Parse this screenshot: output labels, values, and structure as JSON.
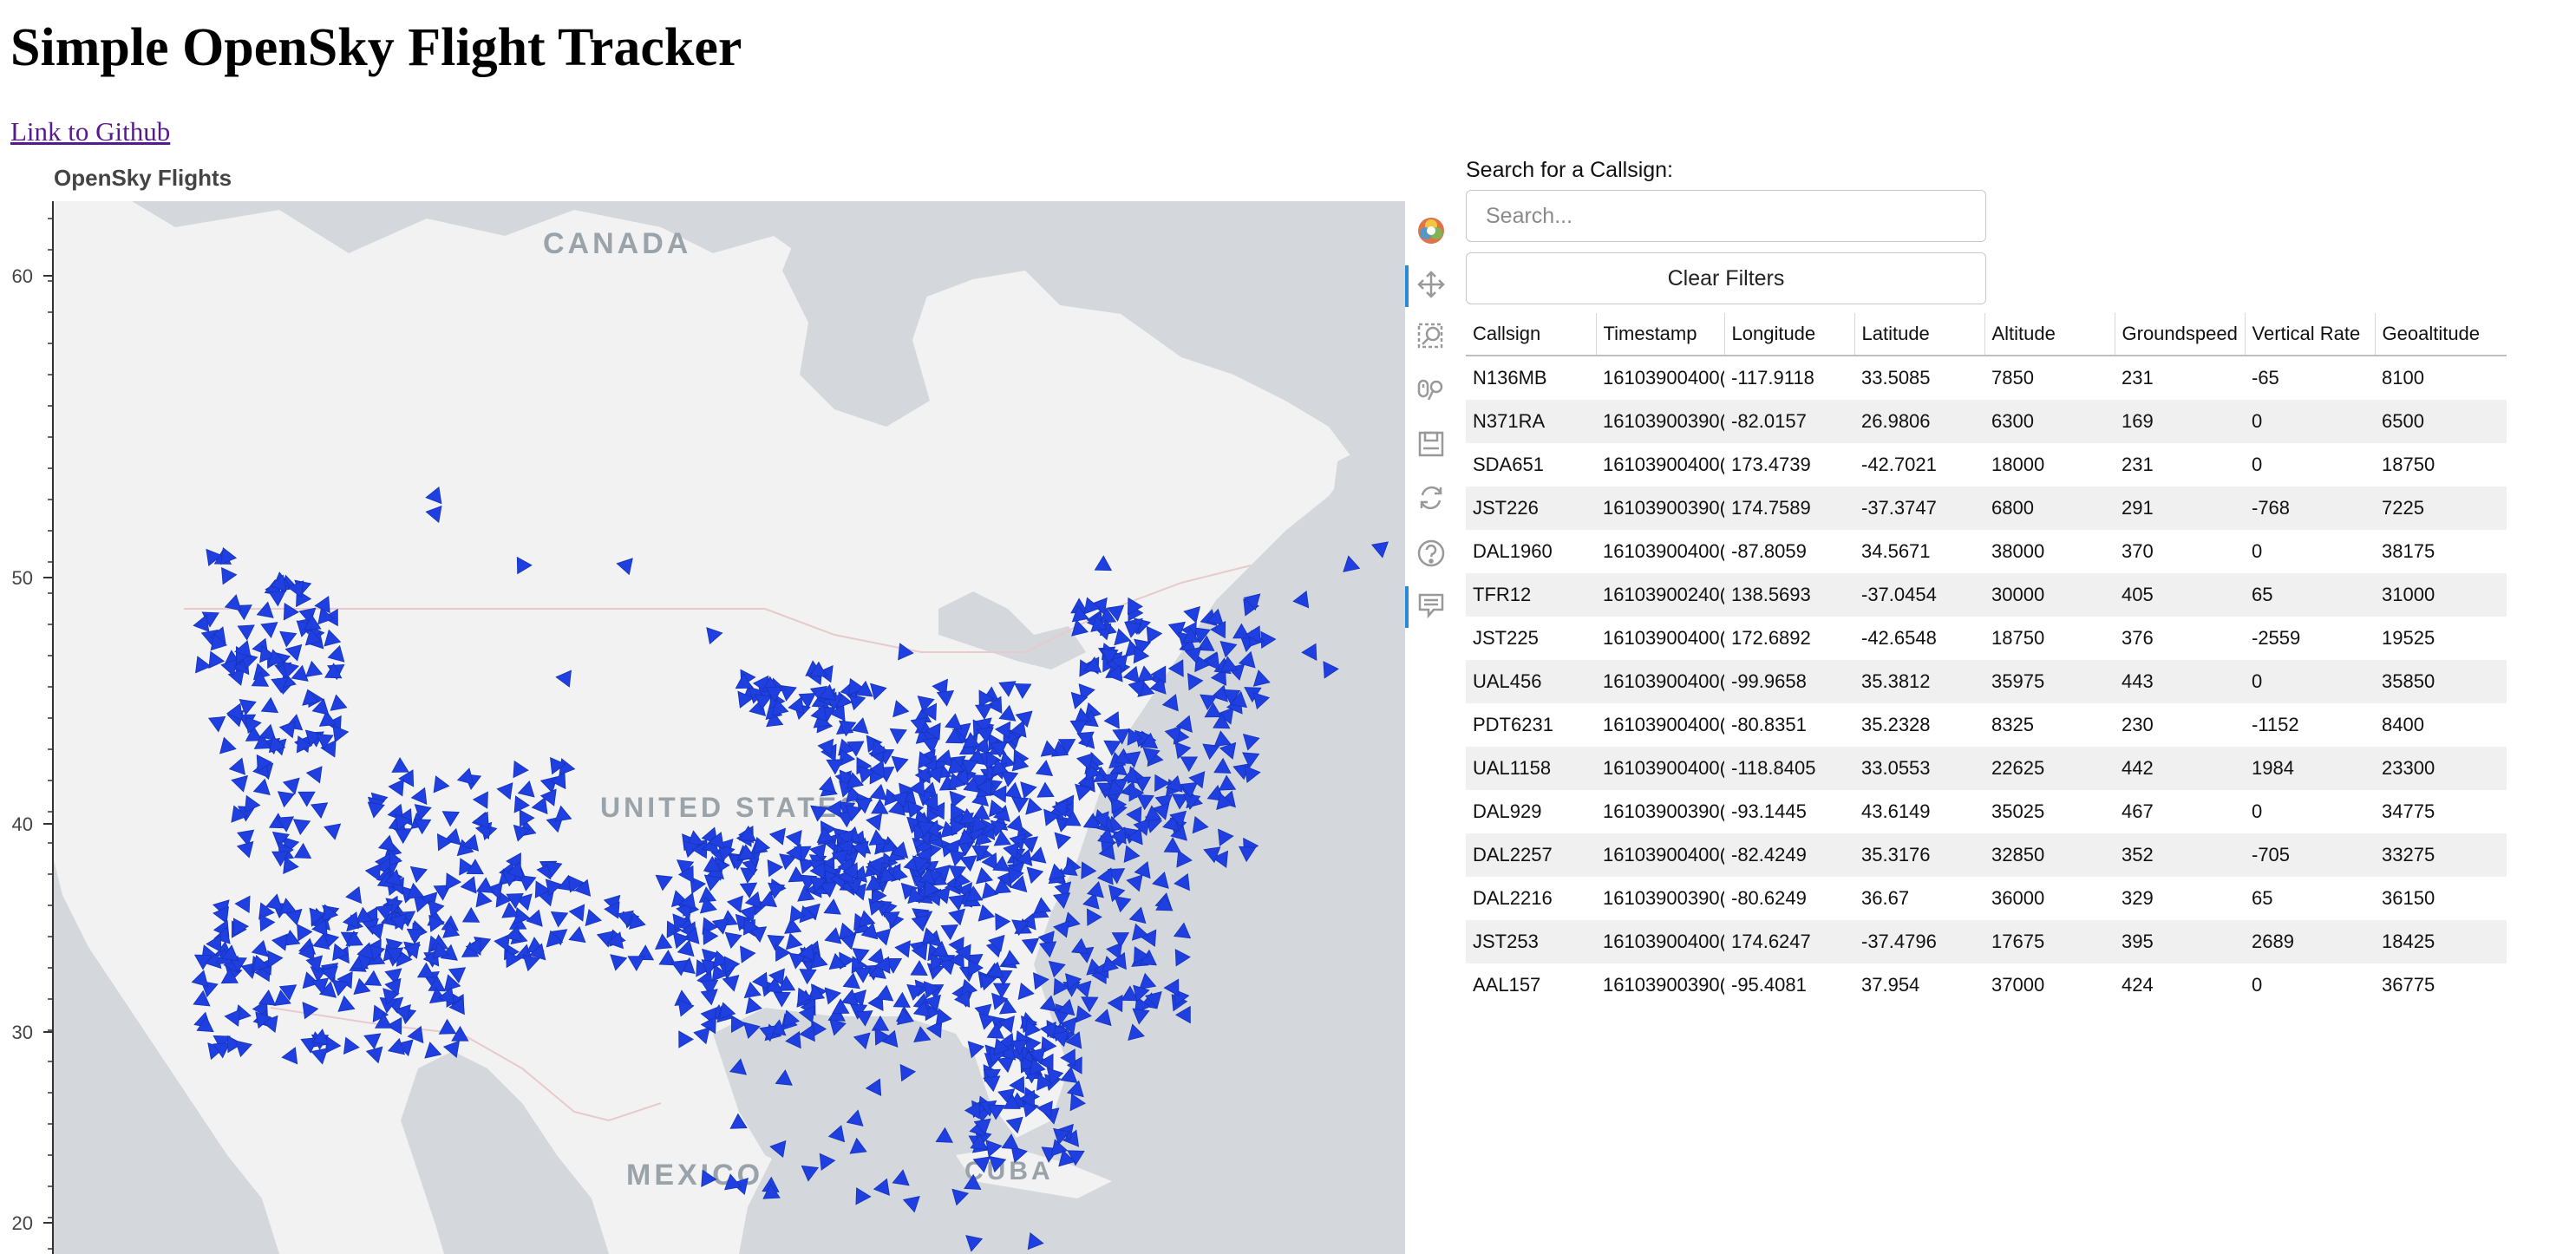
{
  "page": {
    "title": "Simple OpenSky Flight Tracker",
    "github_link": "Link to Github"
  },
  "plot": {
    "title": "OpenSky Flights",
    "y_ticks": [
      "60",
      "50",
      "40",
      "30",
      "20"
    ],
    "map_labels": [
      "CANADA",
      "UNITED STATES",
      "MEXICO",
      "CUBA"
    ],
    "marker_color": "#1f3fe0",
    "water_color": "#d4d8dc",
    "land_color": "#f2f2f2",
    "toolbar": [
      {
        "name": "bokeh-logo-icon",
        "active": false
      },
      {
        "name": "pan-tool-icon",
        "active": true
      },
      {
        "name": "box-zoom-tool-icon",
        "active": false
      },
      {
        "name": "wheel-zoom-tool-icon",
        "active": false
      },
      {
        "name": "save-tool-icon",
        "active": false
      },
      {
        "name": "reset-tool-icon",
        "active": false
      },
      {
        "name": "help-tool-icon",
        "active": false
      },
      {
        "name": "hover-tool-icon",
        "active": true
      }
    ]
  },
  "search": {
    "label": "Search for a Callsign:",
    "placeholder": "Search...",
    "clear_label": "Clear Filters"
  },
  "table": {
    "columns": [
      "Callsign",
      "Timestamp",
      "Longitude",
      "Latitude",
      "Altitude",
      "Groundspeed",
      "Vertical Rate",
      "Geoaltitude"
    ],
    "rows": [
      [
        "N136MB",
        "16103900400(",
        "-117.9118",
        "33.5085",
        "7850",
        "231",
        "-65",
        "8100"
      ],
      [
        "N371RA",
        "16103900390(",
        "-82.0157",
        "26.9806",
        "6300",
        "169",
        "0",
        "6500"
      ],
      [
        "SDA651",
        "16103900400(",
        "173.4739",
        "-42.7021",
        "18000",
        "231",
        "0",
        "18750"
      ],
      [
        "JST226",
        "16103900390(",
        "174.7589",
        "-37.3747",
        "6800",
        "291",
        "-768",
        "7225"
      ],
      [
        "DAL1960",
        "16103900400(",
        "-87.8059",
        "34.5671",
        "38000",
        "370",
        "0",
        "38175"
      ],
      [
        "TFR12",
        "16103900240(",
        "138.5693",
        "-37.0454",
        "30000",
        "405",
        "65",
        "31000"
      ],
      [
        "JST225",
        "16103900400(",
        "172.6892",
        "-42.6548",
        "18750",
        "376",
        "-2559",
        "19525"
      ],
      [
        "UAL456",
        "16103900400(",
        "-99.9658",
        "35.3812",
        "35975",
        "443",
        "0",
        "35850"
      ],
      [
        "PDT6231",
        "16103900400(",
        "-80.8351",
        "35.2328",
        "8325",
        "230",
        "-1152",
        "8400"
      ],
      [
        "UAL1158",
        "16103900400(",
        "-118.8405",
        "33.0553",
        "22625",
        "442",
        "1984",
        "23300"
      ],
      [
        "DAL929",
        "16103900390(",
        "-93.1445",
        "43.6149",
        "35025",
        "467",
        "0",
        "34775"
      ],
      [
        "DAL2257",
        "16103900400(",
        "-82.4249",
        "35.3176",
        "32850",
        "352",
        "-705",
        "33275"
      ],
      [
        "DAL2216",
        "16103900390(",
        "-80.6249",
        "36.67",
        "36000",
        "329",
        "65",
        "36150"
      ],
      [
        "JST253",
        "16103900400(",
        "174.6247",
        "-37.4796",
        "17675",
        "395",
        "2689",
        "18425"
      ],
      [
        "AAL157",
        "16103900390(",
        "-95.4081",
        "37.954",
        "37000",
        "424",
        "0",
        "36775"
      ]
    ]
  }
}
